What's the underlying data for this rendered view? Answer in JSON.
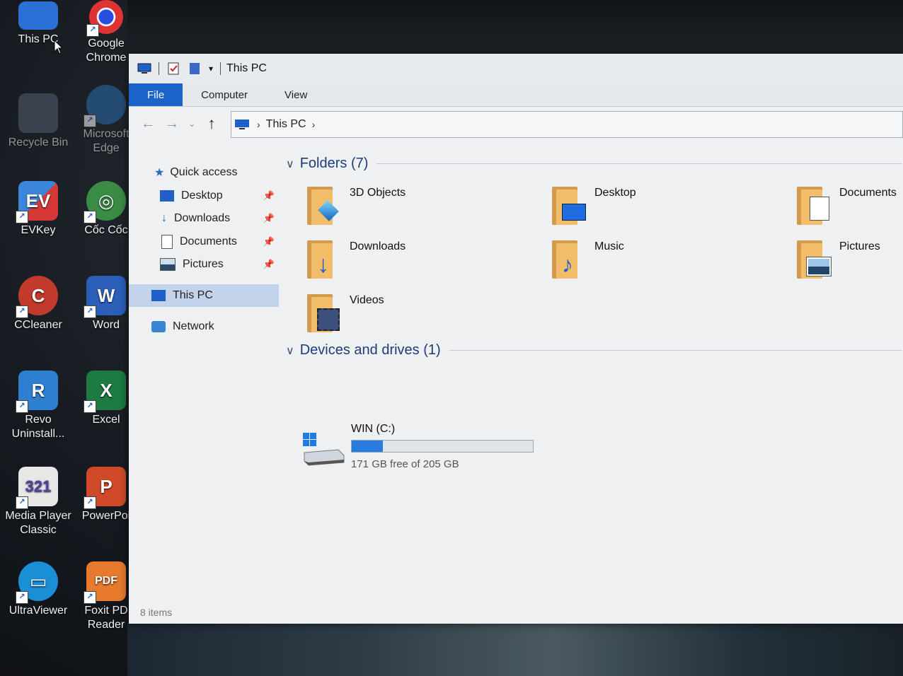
{
  "desktop": {
    "icons": [
      {
        "label": "This PC"
      },
      {
        "label": "Google Chrome"
      },
      {
        "label": "Recycle Bin"
      },
      {
        "label": "Microsoft Edge"
      },
      {
        "label": "EVKey"
      },
      {
        "label": "Cốc Cốc"
      },
      {
        "label": "CCleaner"
      },
      {
        "label": "Word"
      },
      {
        "label": "Revo Uninstall..."
      },
      {
        "label": "Excel"
      },
      {
        "label": "Media Player Classic"
      },
      {
        "label": "PowerPoi"
      },
      {
        "label": "UltraViewer"
      },
      {
        "label": "Foxit PD Reader"
      }
    ]
  },
  "window": {
    "title": "This PC",
    "ribbon_tabs": [
      "File",
      "Computer",
      "View"
    ],
    "address": {
      "crumb": "This PC"
    },
    "nav": {
      "quick_access": "Quick access",
      "items": [
        "Desktop",
        "Downloads",
        "Documents",
        "Pictures"
      ],
      "this_pc": "This PC",
      "network": "Network"
    },
    "folders_header": "Folders (7)",
    "folders": [
      "3D Objects",
      "Desktop",
      "Documents",
      "Downloads",
      "Music",
      "Pictures",
      "Videos"
    ],
    "devices_header": "Devices and drives (1)",
    "drive": {
      "name": "WIN (C:)",
      "free_text": "171 GB free of 205 GB",
      "used_fraction": 0.17
    },
    "status": "8 items"
  },
  "colors": {
    "accent": "#1a63c9",
    "selection": "#c3d3ec",
    "folder": "#f2bd6a"
  }
}
